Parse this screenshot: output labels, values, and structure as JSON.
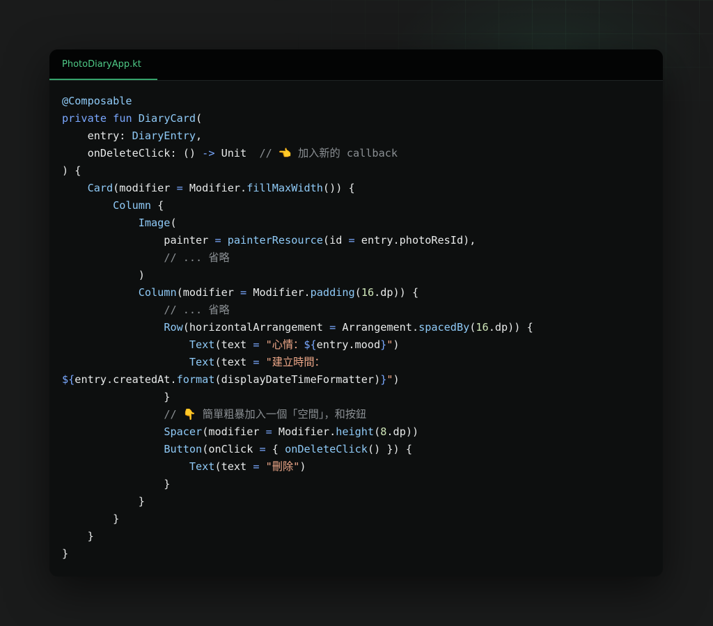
{
  "editor": {
    "tab_label": "PhotoDiaryApp.kt"
  },
  "colors": {
    "background": "#1a1b1b",
    "editor_bg": "#0d0f0f",
    "tab_bar_bg": "#030404",
    "tab_accent": "#4ec986",
    "keyword": "#7aa7ff",
    "function": "#8fcaf7",
    "string": "#f0a98a",
    "number": "#cfe6b8",
    "comment": "#8a8f93",
    "text": "#e8eaea"
  },
  "code_lines": [
    [
      [
        "f",
        "@Composable"
      ]
    ],
    [
      [
        "k",
        "private"
      ],
      [
        "d",
        " "
      ],
      [
        "k",
        "fun"
      ],
      [
        "d",
        " "
      ],
      [
        "f",
        "DiaryCard"
      ],
      [
        "d",
        "("
      ]
    ],
    [
      [
        "d",
        "    entry: "
      ],
      [
        "f",
        "DiaryEntry"
      ],
      [
        "d",
        ","
      ]
    ],
    [
      [
        "d",
        "    onDeleteClick: () "
      ],
      [
        "o",
        "->"
      ],
      [
        "d",
        " Unit  "
      ],
      [
        "c",
        "// 👈 加入新的 callback"
      ]
    ],
    [
      [
        "d",
        ") {"
      ]
    ],
    [
      [
        "d",
        "    "
      ],
      [
        "f",
        "Card"
      ],
      [
        "d",
        "(modifier "
      ],
      [
        "o",
        "="
      ],
      [
        "d",
        " Modifier."
      ],
      [
        "f",
        "fillMaxWidth"
      ],
      [
        "d",
        "()) {"
      ]
    ],
    [
      [
        "d",
        "        "
      ],
      [
        "f",
        "Column"
      ],
      [
        "d",
        " {"
      ]
    ],
    [
      [
        "d",
        "            "
      ],
      [
        "f",
        "Image"
      ],
      [
        "d",
        "("
      ]
    ],
    [
      [
        "d",
        "                painter "
      ],
      [
        "o",
        "="
      ],
      [
        "d",
        " "
      ],
      [
        "f",
        "painterResource"
      ],
      [
        "d",
        "(id "
      ],
      [
        "o",
        "="
      ],
      [
        "d",
        " entry.photoResId),"
      ]
    ],
    [
      [
        "d",
        "                "
      ],
      [
        "c",
        "// ... 省略"
      ]
    ],
    [
      [
        "d",
        "            )"
      ]
    ],
    [
      [
        "d",
        "            "
      ],
      [
        "f",
        "Column"
      ],
      [
        "d",
        "(modifier "
      ],
      [
        "o",
        "="
      ],
      [
        "d",
        " Modifier."
      ],
      [
        "f",
        "padding"
      ],
      [
        "d",
        "("
      ],
      [
        "n",
        "16"
      ],
      [
        "d",
        ".dp)) {"
      ]
    ],
    [
      [
        "d",
        "                "
      ],
      [
        "c",
        "// ... 省略"
      ]
    ],
    [
      [
        "d",
        "                "
      ],
      [
        "f",
        "Row"
      ],
      [
        "d",
        "(horizontalArrangement "
      ],
      [
        "o",
        "="
      ],
      [
        "d",
        " Arrangement."
      ],
      [
        "f",
        "spacedBy"
      ],
      [
        "d",
        "("
      ],
      [
        "n",
        "16"
      ],
      [
        "d",
        ".dp)) {"
      ]
    ],
    [
      [
        "d",
        "                    "
      ],
      [
        "f",
        "Text"
      ],
      [
        "d",
        "(text "
      ],
      [
        "o",
        "="
      ],
      [
        "d",
        " "
      ],
      [
        "s",
        "\"心情："
      ],
      [
        "o",
        "${"
      ],
      [
        "d",
        "entry.mood"
      ],
      [
        "o",
        "}"
      ],
      [
        "s",
        "\""
      ],
      [
        "d",
        ")"
      ]
    ],
    [
      [
        "d",
        "                    "
      ],
      [
        "f",
        "Text"
      ],
      [
        "d",
        "(text "
      ],
      [
        "o",
        "="
      ],
      [
        "d",
        " "
      ],
      [
        "s",
        "\"建立時間："
      ]
    ],
    [
      [
        "o",
        "${"
      ],
      [
        "d",
        "entry.createdAt."
      ],
      [
        "f",
        "format"
      ],
      [
        "d",
        "(displayDateTimeFormatter)"
      ],
      [
        "o",
        "}"
      ],
      [
        "s",
        "\""
      ],
      [
        "d",
        ")"
      ]
    ],
    [
      [
        "d",
        "                }"
      ]
    ],
    [
      [
        "d",
        "                "
      ],
      [
        "c",
        "// 👇 簡單粗暴加入一個「空間」，和按鈕"
      ]
    ],
    [
      [
        "d",
        "                "
      ],
      [
        "f",
        "Spacer"
      ],
      [
        "d",
        "(modifier "
      ],
      [
        "o",
        "="
      ],
      [
        "d",
        " Modifier."
      ],
      [
        "f",
        "height"
      ],
      [
        "d",
        "("
      ],
      [
        "n",
        "8"
      ],
      [
        "d",
        ".dp))"
      ]
    ],
    [
      [
        "d",
        "                "
      ],
      [
        "f",
        "Button"
      ],
      [
        "d",
        "(onClick "
      ],
      [
        "o",
        "="
      ],
      [
        "d",
        " { "
      ],
      [
        "f",
        "onDeleteClick"
      ],
      [
        "d",
        "() }) {"
      ]
    ],
    [
      [
        "d",
        "                    "
      ],
      [
        "f",
        "Text"
      ],
      [
        "d",
        "(text "
      ],
      [
        "o",
        "="
      ],
      [
        "d",
        " "
      ],
      [
        "s",
        "\"刪除\""
      ],
      [
        "d",
        ")"
      ]
    ],
    [
      [
        "d",
        "                }"
      ]
    ],
    [
      [
        "d",
        "            }"
      ]
    ],
    [
      [
        "d",
        "        }"
      ]
    ],
    [
      [
        "d",
        "    }"
      ]
    ],
    [
      [
        "d",
        "}"
      ]
    ]
  ]
}
